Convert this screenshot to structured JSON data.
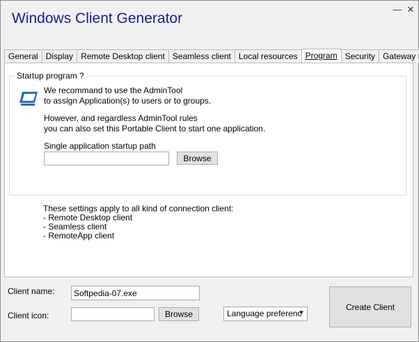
{
  "window": {
    "title": "Windows Client Generator",
    "minimize_glyph": "—",
    "close_glyph": "✕"
  },
  "tabs": [
    {
      "label": "General"
    },
    {
      "label": "Display"
    },
    {
      "label": "Remote Desktop client"
    },
    {
      "label": "Seamless client"
    },
    {
      "label": "Local resources"
    },
    {
      "label": "Program"
    },
    {
      "label": "Security"
    },
    {
      "label": "Gateway Portal"
    }
  ],
  "active_tab": "Program",
  "program": {
    "group_label": "Startup program ?",
    "icon": "monitor-icon",
    "rec_line1": "We recommand to use the AdminTool",
    "rec_line2": "to assign Application(s) to users or to groups.",
    "however_line1": "However, and regardless AdminTool rules",
    "however_line2": "you can also set this Portable Client to start one application.",
    "path_label": "Single application startup path",
    "path_value": "",
    "browse_label": "Browse",
    "note_title": "These settings apply to all kind of connection client:",
    "note_items": [
      " - Remote Desktop client",
      " - Seamless client",
      " - RemoteApp client"
    ]
  },
  "footer": {
    "client_name_label": "Client name:",
    "client_name_value": "Softpedia-07.exe",
    "client_icon_label": "Client icon:",
    "client_icon_value": "",
    "browse_label": "Browse",
    "language_value": "Language preferenc",
    "create_label": "Create Client"
  },
  "colors": {
    "title": "#1c1c8c",
    "icon_blue": "#2a6fb5"
  }
}
